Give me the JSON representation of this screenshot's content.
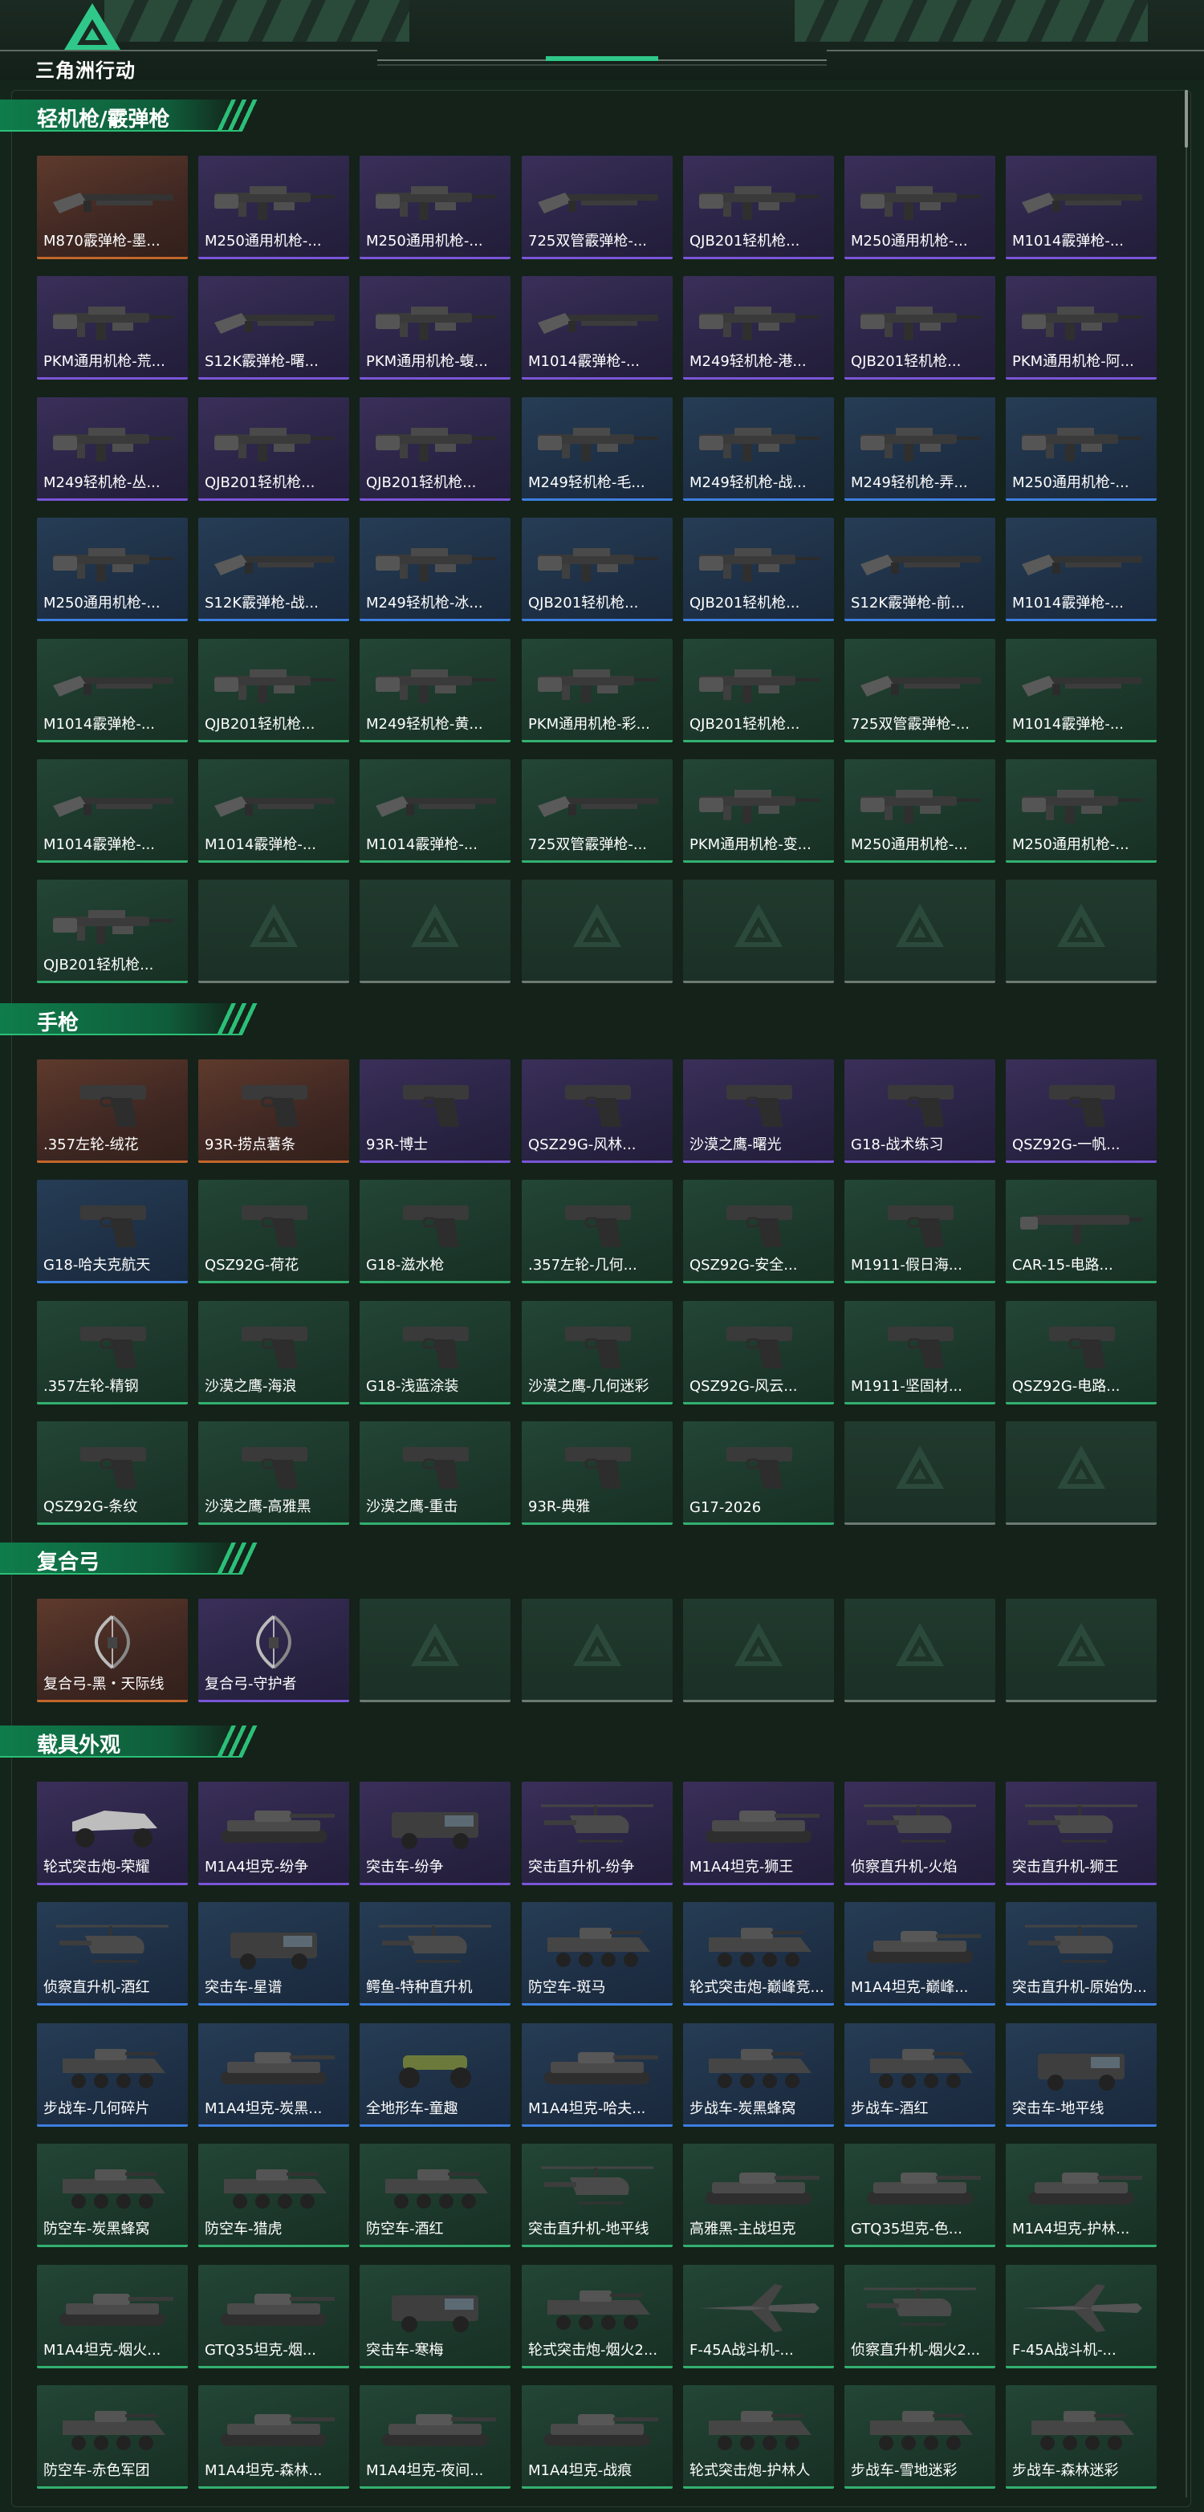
{
  "header": {
    "logo_text": "三角洲行动"
  },
  "sections": [
    {
      "title": "轻机枪/霰弹枪",
      "items": [
        {
          "label": "M870霰弹枪-墨...",
          "rarity": "gold",
          "icon": "shotgun-icon"
        },
        {
          "label": "M250通用机枪-...",
          "rarity": "purple",
          "icon": "machine-gun-icon"
        },
        {
          "label": "M250通用机枪-...",
          "rarity": "purple",
          "icon": "machine-gun-icon"
        },
        {
          "label": "725双管霰弹枪-...",
          "rarity": "purple",
          "icon": "shotgun-icon"
        },
        {
          "label": "QJB201轻机枪...",
          "rarity": "purple",
          "icon": "machine-gun-icon"
        },
        {
          "label": "M250通用机枪-...",
          "rarity": "purple",
          "icon": "machine-gun-icon"
        },
        {
          "label": "M1014霰弹枪-...",
          "rarity": "purple",
          "icon": "shotgun-icon"
        },
        {
          "label": "PKM通用机枪-荒...",
          "rarity": "purple",
          "icon": "machine-gun-icon"
        },
        {
          "label": "S12K霰弹枪-曙...",
          "rarity": "purple",
          "icon": "shotgun-icon"
        },
        {
          "label": "PKM通用机枪-蝮...",
          "rarity": "purple",
          "icon": "machine-gun-icon"
        },
        {
          "label": "M1014霰弹枪-...",
          "rarity": "purple",
          "icon": "shotgun-icon"
        },
        {
          "label": "M249轻机枪-港...",
          "rarity": "purple",
          "icon": "machine-gun-icon"
        },
        {
          "label": "QJB201轻机枪...",
          "rarity": "purple",
          "icon": "machine-gun-icon"
        },
        {
          "label": "PKM通用机枪-阿...",
          "rarity": "purple",
          "icon": "machine-gun-icon"
        },
        {
          "label": "M249轻机枪-丛...",
          "rarity": "purple",
          "icon": "machine-gun-icon"
        },
        {
          "label": "QJB201轻机枪...",
          "rarity": "purple",
          "icon": "machine-gun-icon"
        },
        {
          "label": "QJB201轻机枪...",
          "rarity": "purple",
          "icon": "machine-gun-icon"
        },
        {
          "label": "M249轻机枪-毛...",
          "rarity": "blue",
          "icon": "machine-gun-icon"
        },
        {
          "label": "M249轻机枪-战...",
          "rarity": "blue",
          "icon": "machine-gun-icon"
        },
        {
          "label": "M249轻机枪-弄...",
          "rarity": "blue",
          "icon": "machine-gun-icon"
        },
        {
          "label": "M250通用机枪-...",
          "rarity": "blue",
          "icon": "machine-gun-icon"
        },
        {
          "label": "M250通用机枪-...",
          "rarity": "blue",
          "icon": "machine-gun-icon"
        },
        {
          "label": "S12K霰弹枪-战...",
          "rarity": "blue",
          "icon": "shotgun-icon"
        },
        {
          "label": "M249轻机枪-冰...",
          "rarity": "blue",
          "icon": "machine-gun-icon"
        },
        {
          "label": "QJB201轻机枪...",
          "rarity": "blue",
          "icon": "machine-gun-icon"
        },
        {
          "label": "QJB201轻机枪...",
          "rarity": "blue",
          "icon": "machine-gun-icon"
        },
        {
          "label": "S12K霰弹枪-前...",
          "rarity": "blue",
          "icon": "shotgun-icon"
        },
        {
          "label": "M1014霰弹枪-...",
          "rarity": "blue",
          "icon": "shotgun-icon"
        },
        {
          "label": "M1014霰弹枪-...",
          "rarity": "green",
          "icon": "shotgun-icon"
        },
        {
          "label": "QJB201轻机枪...",
          "rarity": "green",
          "icon": "machine-gun-icon"
        },
        {
          "label": "M249轻机枪-黄...",
          "rarity": "green",
          "icon": "machine-gun-icon"
        },
        {
          "label": "PKM通用机枪-彩...",
          "rarity": "green",
          "icon": "machine-gun-icon"
        },
        {
          "label": "QJB201轻机枪...",
          "rarity": "green",
          "icon": "machine-gun-icon"
        },
        {
          "label": "725双管霰弹枪-...",
          "rarity": "green",
          "icon": "shotgun-icon"
        },
        {
          "label": "M1014霰弹枪-...",
          "rarity": "green",
          "icon": "shotgun-icon"
        },
        {
          "label": "M1014霰弹枪-...",
          "rarity": "green",
          "icon": "shotgun-icon"
        },
        {
          "label": "M1014霰弹枪-...",
          "rarity": "green",
          "icon": "shotgun-icon"
        },
        {
          "label": "M1014霰弹枪-...",
          "rarity": "green",
          "icon": "shotgun-icon"
        },
        {
          "label": "725双管霰弹枪-...",
          "rarity": "green",
          "icon": "shotgun-icon"
        },
        {
          "label": "PKM通用机枪-变...",
          "rarity": "green",
          "icon": "machine-gun-icon"
        },
        {
          "label": "M250通用机枪-...",
          "rarity": "green",
          "icon": "machine-gun-icon"
        },
        {
          "label": "M250通用机枪-...",
          "rarity": "green",
          "icon": "machine-gun-icon"
        },
        {
          "label": "QJB201轻机枪...",
          "rarity": "green",
          "icon": "machine-gun-icon"
        },
        {
          "label": "",
          "rarity": "empty",
          "icon": "placeholder-icon"
        },
        {
          "label": "",
          "rarity": "empty",
          "icon": "placeholder-icon"
        },
        {
          "label": "",
          "rarity": "empty",
          "icon": "placeholder-icon"
        },
        {
          "label": "",
          "rarity": "empty",
          "icon": "placeholder-icon"
        },
        {
          "label": "",
          "rarity": "empty",
          "icon": "placeholder-icon"
        },
        {
          "label": "",
          "rarity": "empty",
          "icon": "placeholder-icon"
        }
      ]
    },
    {
      "title": "手枪",
      "items": [
        {
          "label": ".357左轮-绒花",
          "rarity": "gold",
          "icon": "pistol-icon"
        },
        {
          "label": "93R-捞点薯条",
          "rarity": "gold",
          "icon": "pistol-icon"
        },
        {
          "label": "93R-博士",
          "rarity": "purple",
          "icon": "pistol-icon"
        },
        {
          "label": "QSZ29G-风林...",
          "rarity": "purple",
          "icon": "pistol-icon"
        },
        {
          "label": "沙漠之鹰-曙光",
          "rarity": "purple",
          "icon": "pistol-icon"
        },
        {
          "label": "G18-战术练习",
          "rarity": "purple",
          "icon": "pistol-icon"
        },
        {
          "label": "QSZ92G-一帆...",
          "rarity": "purple",
          "icon": "pistol-icon"
        },
        {
          "label": "G18-哈夫克航天",
          "rarity": "blue",
          "icon": "pistol-icon"
        },
        {
          "label": "QSZ92G-荷花",
          "rarity": "green",
          "icon": "pistol-icon"
        },
        {
          "label": "G18-滋水枪",
          "rarity": "green",
          "icon": "pistol-icon"
        },
        {
          "label": ".357左轮-几何...",
          "rarity": "green",
          "icon": "pistol-icon"
        },
        {
          "label": "QSZ92G-安全...",
          "rarity": "green",
          "icon": "pistol-icon"
        },
        {
          "label": "M1911-假日海...",
          "rarity": "green",
          "icon": "pistol-icon"
        },
        {
          "label": "CAR-15-电路...",
          "rarity": "green",
          "icon": "rifle-icon"
        },
        {
          "label": ".357左轮-精钢",
          "rarity": "green",
          "icon": "pistol-icon"
        },
        {
          "label": "沙漠之鹰-海浪",
          "rarity": "green",
          "icon": "pistol-icon"
        },
        {
          "label": "G18-浅蓝涂装",
          "rarity": "green",
          "icon": "pistol-icon"
        },
        {
          "label": "沙漠之鹰-几何迷彩",
          "rarity": "green",
          "icon": "pistol-icon"
        },
        {
          "label": "QSZ92G-风云...",
          "rarity": "green",
          "icon": "pistol-icon"
        },
        {
          "label": "M1911-坚固材...",
          "rarity": "green",
          "icon": "pistol-icon"
        },
        {
          "label": "QSZ92G-电路...",
          "rarity": "green",
          "icon": "pistol-icon"
        },
        {
          "label": "QSZ92G-条纹",
          "rarity": "green",
          "icon": "pistol-icon"
        },
        {
          "label": "沙漠之鹰-高雅黑",
          "rarity": "green",
          "icon": "pistol-icon"
        },
        {
          "label": "沙漠之鹰-重击",
          "rarity": "green",
          "icon": "pistol-icon"
        },
        {
          "label": "93R-典雅",
          "rarity": "green",
          "icon": "pistol-icon"
        },
        {
          "label": "G17-2026",
          "rarity": "green",
          "icon": "pistol-icon"
        },
        {
          "label": "",
          "rarity": "empty",
          "icon": "placeholder-icon"
        },
        {
          "label": "",
          "rarity": "empty",
          "icon": "placeholder-icon"
        }
      ]
    },
    {
      "title": "复合弓",
      "items": [
        {
          "label": "复合弓-黑・天际线",
          "rarity": "gold",
          "icon": "bow-icon"
        },
        {
          "label": "复合弓-守护者",
          "rarity": "purple",
          "icon": "bow-icon"
        },
        {
          "label": "",
          "rarity": "empty",
          "icon": "placeholder-icon"
        },
        {
          "label": "",
          "rarity": "empty",
          "icon": "placeholder-icon"
        },
        {
          "label": "",
          "rarity": "empty",
          "icon": "placeholder-icon"
        },
        {
          "label": "",
          "rarity": "empty",
          "icon": "placeholder-icon"
        },
        {
          "label": "",
          "rarity": "empty",
          "icon": "placeholder-icon"
        }
      ]
    },
    {
      "title": "载具外观",
      "items": [
        {
          "label": "轮式突击炮-荣耀",
          "rarity": "purple",
          "icon": "buggy-icon"
        },
        {
          "label": "M1A4坦克-纷争",
          "rarity": "purple",
          "icon": "tank-icon"
        },
        {
          "label": "突击车-纷争",
          "rarity": "purple",
          "icon": "truck-icon"
        },
        {
          "label": "突击直升机-纷争",
          "rarity": "purple",
          "icon": "helicopter-icon"
        },
        {
          "label": "M1A4坦克-狮王",
          "rarity": "purple",
          "icon": "tank-icon"
        },
        {
          "label": "侦察直升机-火焰",
          "rarity": "purple",
          "icon": "helicopter-icon"
        },
        {
          "label": "突击直升机-狮王",
          "rarity": "purple",
          "icon": "helicopter-icon"
        },
        {
          "label": "侦察直升机-酒红",
          "rarity": "blue",
          "icon": "helicopter-icon"
        },
        {
          "label": "突击车-星谱",
          "rarity": "blue",
          "icon": "truck-icon"
        },
        {
          "label": "鳄鱼-特种直升机",
          "rarity": "blue",
          "icon": "helicopter-icon"
        },
        {
          "label": "防空车-斑马",
          "rarity": "blue",
          "icon": "apc-icon"
        },
        {
          "label": "轮式突击炮-巅峰竞...",
          "rarity": "blue",
          "icon": "apc-icon"
        },
        {
          "label": "M1A4坦克-巅峰...",
          "rarity": "blue",
          "icon": "tank-icon"
        },
        {
          "label": "突击直升机-原始伪...",
          "rarity": "blue",
          "icon": "helicopter-icon"
        },
        {
          "label": "步战车-几何碎片",
          "rarity": "blue",
          "icon": "apc-icon"
        },
        {
          "label": "M1A4坦克-炭黑...",
          "rarity": "blue",
          "icon": "tank-icon"
        },
        {
          "label": "全地形车-童趣",
          "rarity": "blue",
          "icon": "atv-icon"
        },
        {
          "label": "M1A4坦克-哈夫...",
          "rarity": "blue",
          "icon": "tank-icon"
        },
        {
          "label": "步战车-炭黑蜂窝",
          "rarity": "blue",
          "icon": "apc-icon"
        },
        {
          "label": "步战车-酒红",
          "rarity": "blue",
          "icon": "apc-icon"
        },
        {
          "label": "突击车-地平线",
          "rarity": "blue",
          "icon": "truck-icon"
        },
        {
          "label": "防空车-炭黑蜂窝",
          "rarity": "green",
          "icon": "apc-icon"
        },
        {
          "label": "防空车-猎虎",
          "rarity": "green",
          "icon": "apc-icon"
        },
        {
          "label": "防空车-酒红",
          "rarity": "green",
          "icon": "apc-icon"
        },
        {
          "label": "突击直升机-地平线",
          "rarity": "green",
          "icon": "helicopter-icon"
        },
        {
          "label": "高雅黑-主战坦克",
          "rarity": "green",
          "icon": "tank-icon"
        },
        {
          "label": "GTQ35坦克-色...",
          "rarity": "green",
          "icon": "tank-icon"
        },
        {
          "label": "M1A4坦克-护林...",
          "rarity": "green",
          "icon": "tank-icon"
        },
        {
          "label": "M1A4坦克-烟火...",
          "rarity": "green",
          "icon": "tank-icon"
        },
        {
          "label": "GTQ35坦克-烟...",
          "rarity": "green",
          "icon": "tank-icon"
        },
        {
          "label": "突击车-寒梅",
          "rarity": "green",
          "icon": "truck-icon"
        },
        {
          "label": "轮式突击炮-烟火2...",
          "rarity": "green",
          "icon": "apc-icon"
        },
        {
          "label": "F-45A战斗机-...",
          "rarity": "green",
          "icon": "jet-icon"
        },
        {
          "label": "侦察直升机-烟火2...",
          "rarity": "green",
          "icon": "helicopter-icon"
        },
        {
          "label": "F-45A战斗机-...",
          "rarity": "green",
          "icon": "jet-icon"
        },
        {
          "label": "防空车-赤色军团",
          "rarity": "green",
          "icon": "apc-icon"
        },
        {
          "label": "M1A4坦克-森林...",
          "rarity": "green",
          "icon": "tank-icon"
        },
        {
          "label": "M1A4坦克-夜间...",
          "rarity": "green",
          "icon": "tank-icon"
        },
        {
          "label": "M1A4坦克-战痕",
          "rarity": "green",
          "icon": "tank-icon"
        },
        {
          "label": "轮式突击炮-护林人",
          "rarity": "green",
          "icon": "apc-icon"
        },
        {
          "label": "步战车-雪地迷彩",
          "rarity": "green",
          "icon": "apc-icon"
        },
        {
          "label": "步战车-森林迷彩",
          "rarity": "green",
          "icon": "apc-icon"
        }
      ]
    }
  ],
  "colors": {
    "background": "#14251c",
    "accent": "#2bbf78",
    "rarity_gold": "#c2662b",
    "rarity_purple": "#7a55d8",
    "rarity_blue": "#3d7fe0",
    "rarity_green": "#33b070"
  }
}
